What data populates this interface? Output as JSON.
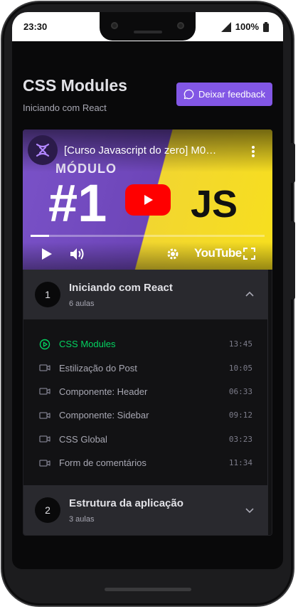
{
  "status_bar": {
    "time": "23:30",
    "battery": "100%"
  },
  "header": {
    "title": "CSS Modules",
    "subtitle": "Iniciando com React",
    "feedback_label": "Deixar feedback"
  },
  "video": {
    "title": "[Curso Javascript do zero] M0…",
    "thumbnail_label": "MÓDULO",
    "thumbnail_number": "#1",
    "thumbnail_js": "JS",
    "platform": "YouTube",
    "progress": 0.08,
    "colors": {
      "purple": "#7a52c8",
      "yellow": "#f7df1e",
      "play_red": "#ff0000"
    }
  },
  "sections": [
    {
      "number": "1",
      "title": "Iniciando com React",
      "count": "6 aulas",
      "expanded": true,
      "lessons": [
        {
          "title": "CSS Modules",
          "time": "13:45",
          "icon": "play-circle-icon",
          "active": true
        },
        {
          "title": "Estilização do Post",
          "time": "10:05",
          "icon": "video-camera-icon",
          "active": false
        },
        {
          "title": "Componente: Header",
          "time": "06:33",
          "icon": "video-camera-icon",
          "active": false
        },
        {
          "title": "Componente: Sidebar",
          "time": "09:12",
          "icon": "video-camera-icon",
          "active": false
        },
        {
          "title": "CSS Global",
          "time": "03:23",
          "icon": "video-camera-icon",
          "active": false
        },
        {
          "title": "Form de comentários",
          "time": "11:34",
          "icon": "video-camera-icon",
          "active": false
        }
      ]
    },
    {
      "number": "2",
      "title": "Estrutura da aplicação",
      "count": "3 aulas",
      "expanded": false
    }
  ],
  "colors": {
    "accent": "#8257e5",
    "active_lesson": "#04d361",
    "background": "#09090a"
  }
}
